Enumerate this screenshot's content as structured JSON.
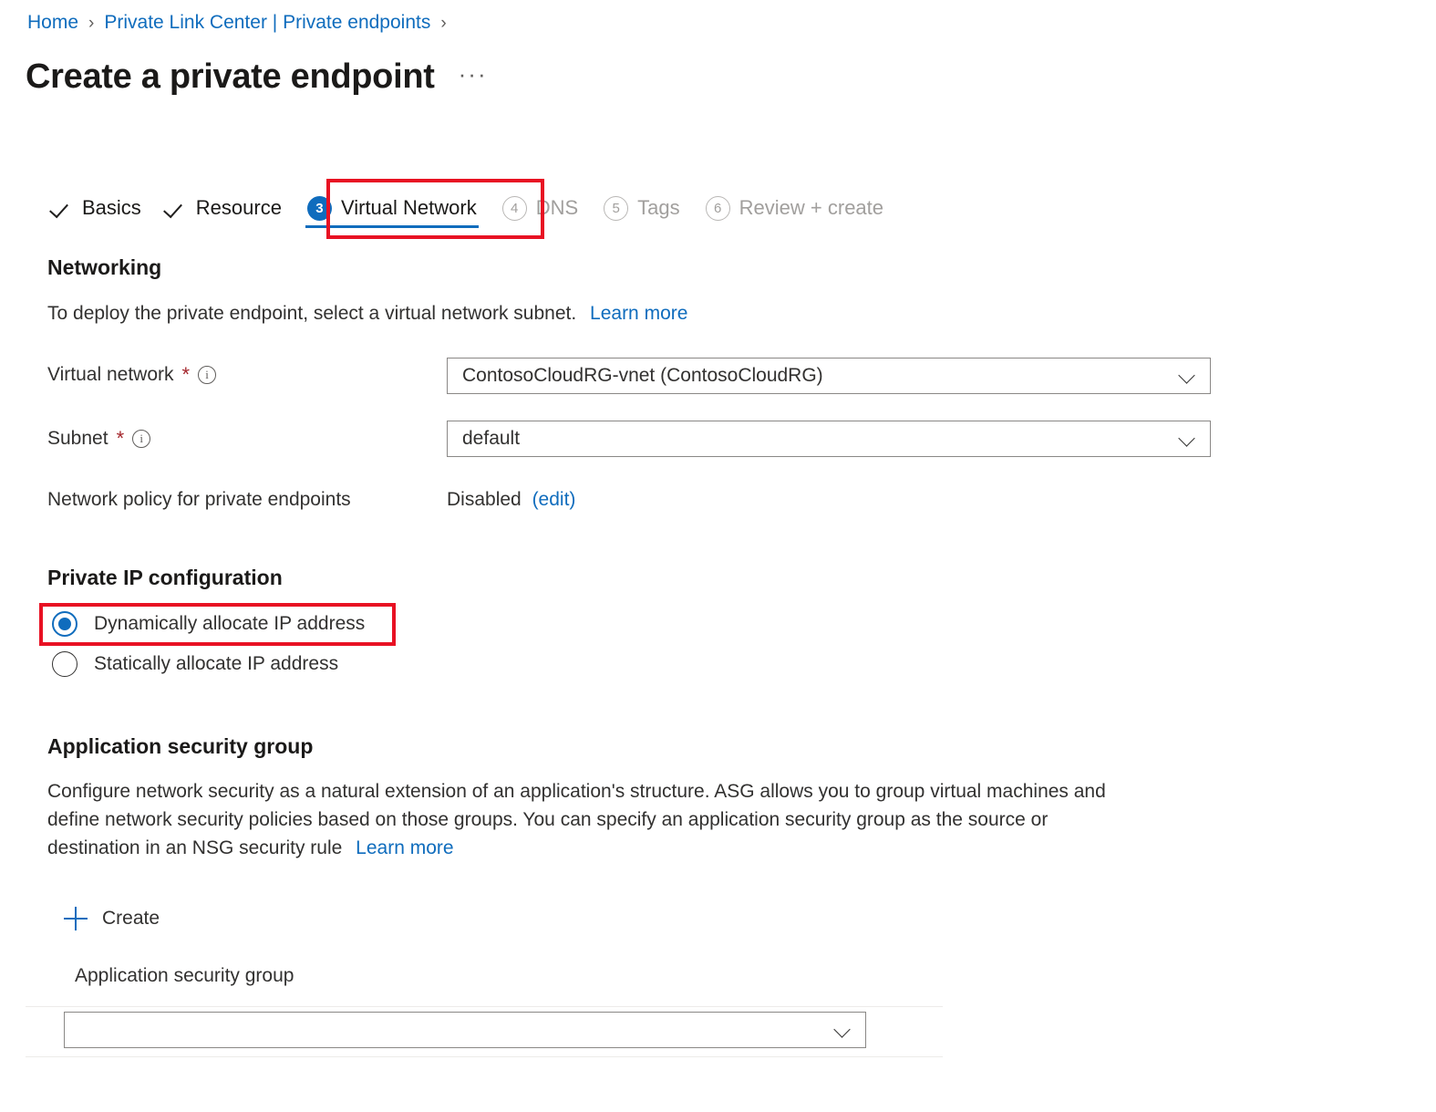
{
  "breadcrumb": {
    "items": [
      {
        "label": "Home"
      },
      {
        "label": "Private Link Center | Private endpoints"
      }
    ],
    "separator": "›"
  },
  "header": {
    "title": "Create a private endpoint",
    "more_label": "···"
  },
  "wizard": {
    "tabs": [
      {
        "label": "Basics",
        "state": "done",
        "marker": "check"
      },
      {
        "label": "Resource",
        "state": "done",
        "marker": "check"
      },
      {
        "label": "Virtual Network",
        "state": "current",
        "marker": "3"
      },
      {
        "label": "DNS",
        "state": "pending",
        "marker": "4"
      },
      {
        "label": "Tags",
        "state": "pending",
        "marker": "5"
      },
      {
        "label": "Review + create",
        "state": "pending",
        "marker": "6"
      }
    ],
    "active_index": 2
  },
  "networking": {
    "heading": "Networking",
    "description": "To deploy the private endpoint, select a virtual network subnet.",
    "learn_more": "Learn more",
    "virtual_network": {
      "label": "Virtual network",
      "required_mark": "*",
      "info_glyph": "i",
      "value": "ContosoCloudRG-vnet (ContosoCloudRG)"
    },
    "subnet": {
      "label": "Subnet",
      "required_mark": "*",
      "info_glyph": "i",
      "value": "default"
    },
    "network_policy": {
      "label": "Network policy for private endpoints",
      "value": "Disabled",
      "edit_link": "(edit)"
    }
  },
  "private_ip": {
    "heading": "Private IP configuration",
    "options": [
      {
        "label": "Dynamically allocate IP address",
        "selected": true
      },
      {
        "label": "Statically allocate IP address",
        "selected": false
      }
    ]
  },
  "asg": {
    "heading": "Application security group",
    "description_line1": "Configure network security as a natural extension of an application's structure. ASG allows you to group virtual machines and",
    "description_line2": "define network security policies based on those groups. You can specify an application security group as the source or",
    "description_line3": "destination in an NSG security rule",
    "learn_more": "Learn more",
    "create_label": "Create",
    "field_label": "Application security group",
    "field_value": "",
    "field_placeholder": ""
  },
  "colors": {
    "link": "#0f6cbd",
    "accent": "#0f6cbd",
    "highlight": "#e81123",
    "required": "#a4262c",
    "text": "#323130",
    "muted": "#a19f9d",
    "border": "#8a8886"
  }
}
